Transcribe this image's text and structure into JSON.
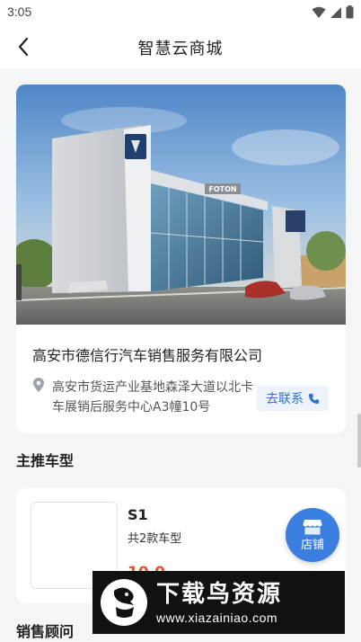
{
  "status_bar": {
    "time": "3:05"
  },
  "nav": {
    "title": "智慧云商城"
  },
  "store": {
    "company_name": "高安市德信行汽车销售服务有限公司",
    "address": "高安市货运产业基地森泽大道以北卡车展销后服务中心A3幢10号",
    "contact_label": "去联系",
    "photo_sign_text": "FOTON"
  },
  "sections": {
    "main_models": "主推车型",
    "sales_advisor": "销售顾问"
  },
  "model": {
    "name": "S1",
    "count_text": "共2款车型",
    "price": "10.0"
  },
  "shop_button": {
    "label": "店铺"
  },
  "watermark": {
    "title": "下载鸟资源",
    "url": "www.xiazainiao.com"
  },
  "colors": {
    "accent": "#3a7fe0",
    "price": "#e8532f",
    "contact_bg": "#eef3fb"
  }
}
